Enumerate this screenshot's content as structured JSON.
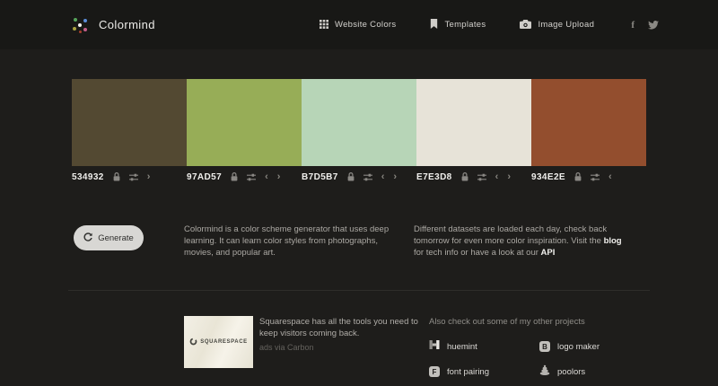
{
  "header": {
    "brand": "Colormind",
    "nav": [
      {
        "label": "Website Colors",
        "icon": "grid-icon"
      },
      {
        "label": "Templates",
        "icon": "bookmark-icon"
      },
      {
        "label": "Image Upload",
        "icon": "camera-icon"
      }
    ],
    "social": {
      "facebook_glyph": "f",
      "icons": [
        "facebook-icon",
        "twitter-icon"
      ]
    }
  },
  "palette": {
    "swatches": [
      {
        "label": "534932",
        "color": "#534932"
      },
      {
        "label": "97AD57",
        "color": "#97AD57"
      },
      {
        "label": "B7D5B7",
        "color": "#B7D5B7"
      },
      {
        "label": "E7E3D8",
        "color": "#E7E3D8"
      },
      {
        "label": "934E2E",
        "color": "#934E2E"
      }
    ]
  },
  "glyphs": {
    "prev": "‹",
    "next": "›"
  },
  "generate": {
    "label": "Generate"
  },
  "about": {
    "text": "Colormind is a color scheme generator that uses deep learning. It can learn color styles from photographs, movies, and popular art."
  },
  "info": {
    "part1": "Different datasets are loaded each day, check back tomorrow for even more color inspiration. Visit the ",
    "blog": "blog",
    "part2": " for tech info or have a look at our ",
    "api": "API"
  },
  "ad": {
    "brand": "SQUARESPACE",
    "headline": "Squarespace has all the tools you need to keep visitors coming back.",
    "attribution": "ads via Carbon"
  },
  "projects": {
    "heading": "Also check out some of my other projects",
    "items": [
      {
        "label": "huemint"
      },
      {
        "label": "logo maker"
      },
      {
        "label": "font pairing"
      },
      {
        "label": "poolors"
      }
    ]
  },
  "theme": {
    "header_bg": "#181816",
    "page_bg": "#1e1d1b",
    "text_muted": "#aba8a3",
    "text_bright": "#f2f1ee"
  }
}
